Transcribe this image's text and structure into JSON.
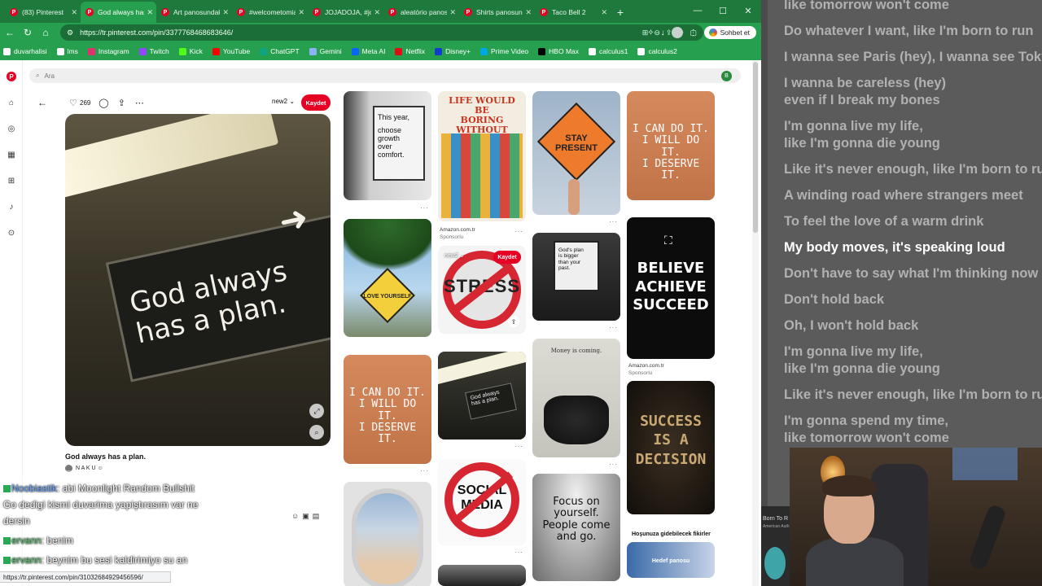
{
  "tabs": [
    {
      "label": "(83) Pinterest",
      "active": false
    },
    {
      "label": "God always has",
      "active": true
    },
    {
      "label": "Art panosundaki",
      "active": false
    },
    {
      "label": "#welcometomia",
      "active": false
    },
    {
      "label": "JOJADOJA, #joja",
      "active": false
    },
    {
      "label": "aleatório panos",
      "active": false
    },
    {
      "label": "Shirts panosund",
      "active": false
    },
    {
      "label": "Taco Bell 2",
      "active": false
    }
  ],
  "window": {
    "minimize": "—",
    "maximize": "☐",
    "close": "✕",
    "new_tab": "+"
  },
  "address": {
    "url": "https://tr.pinterest.com/pin/3377768468683646/"
  },
  "chat_button": "Sohbet et",
  "bookmarks": [
    {
      "label": "duvarhalisi",
      "color": "#ffffff"
    },
    {
      "label": "lms",
      "color": "#ffffff"
    },
    {
      "label": "Instagram",
      "color": "#e1306c"
    },
    {
      "label": "Twitch",
      "color": "#9146ff"
    },
    {
      "label": "Kick",
      "color": "#53fc18"
    },
    {
      "label": "YouTube",
      "color": "#ff0000"
    },
    {
      "label": "ChatGPT",
      "color": "#10a37f"
    },
    {
      "label": "Gemini",
      "color": "#8ab4f8"
    },
    {
      "label": "Meta AI",
      "color": "#0866ff"
    },
    {
      "label": "Netflix",
      "color": "#e50914"
    },
    {
      "label": "Disney+",
      "color": "#113ccf"
    },
    {
      "label": "Prime Video",
      "color": "#00a8e1"
    },
    {
      "label": "HBO Max",
      "color": "#000000"
    },
    {
      "label": "calculus1",
      "color": "#ffffff"
    },
    {
      "label": "calculus2",
      "color": "#ffffff"
    }
  ],
  "search": {
    "placeholder": "Ara"
  },
  "user_initial": "B",
  "pin": {
    "likes": "269",
    "board": "new2",
    "save_label": "Kaydet",
    "sign_line1": "God always",
    "sign_line2": "has a plan.",
    "title": "God always has a plan.",
    "author": "N A K U ☺"
  },
  "grid": {
    "this_year": [
      "This year,",
      "choose",
      "growth",
      "over",
      "comfort."
    ],
    "buses": [
      "LIFE WOULD BE",
      "BORING",
      "WITHOUT BUSES"
    ],
    "stay_present": [
      "STAY",
      "PRESENT"
    ],
    "i_can_do_it": [
      "I CAN DO IT.",
      "I WILL DO IT.",
      "I DESERVE IT."
    ],
    "love_yourself": "LOVE YOURSELF",
    "stress": "STRESS",
    "gods_plan": [
      "God's plan",
      "is bigger",
      "than your",
      "past."
    ],
    "believe": [
      "BELIEVE",
      "ACHIEVE",
      "SUCCEED"
    ],
    "money": "Money is coming.",
    "social_media": [
      "SOCIAL",
      "MEDIA"
    ],
    "focus": [
      "Focus on",
      "yourself.",
      "People come",
      "and go."
    ],
    "success": [
      "SUCCESS",
      "IS A",
      "DECISION"
    ],
    "hover_board": "new2",
    "hover_save": "Kaydet",
    "promo1": {
      "source": "Amazon.com.tr",
      "label": "Sponsorlu"
    },
    "promo2": {
      "source": "Amazon.com.tr",
      "label": "Sponsorlu"
    },
    "more_ideas": "Hoşunuza gidebilecek fikirler",
    "board_card": "Hedef panosu"
  },
  "chat": {
    "m1_user": "Noobiastik",
    "m1_text": ": abi Moonlight Random Bullshit Go dedigi kismi duvarima yapiştırasım var ne dersin",
    "m2_user": "ervann",
    "m2_text": ": benim",
    "m3_user": "ervann",
    "m3_text": ": beynim bu sesi kaldirimiyo su an"
  },
  "status_url": "https://tr.pinterest.com/pin/31032684929456596/",
  "lyrics": [
    {
      "text": "like tomorrow won't come",
      "active": false
    },
    {
      "text": "Do whatever I want, like I'm born to run",
      "active": false
    },
    {
      "text": "I wanna see Paris (hey), I wanna see Tokyo",
      "active": false
    },
    {
      "text": "I wanna be careless (hey)",
      "active": false
    },
    {
      "text": "even if I break my bones",
      "active": false
    },
    {
      "text": "I'm gonna live my life,",
      "active": false
    },
    {
      "text": "like I'm gonna die young",
      "active": false
    },
    {
      "text": "Like it's never enough, like I'm born to run",
      "active": false
    },
    {
      "text": "A winding road where strangers meet",
      "active": false
    },
    {
      "text": "To feel the love of a warm drink",
      "active": false
    },
    {
      "text": "My body moves, it's speaking loud",
      "active": true
    },
    {
      "text": "Don't have to say what I'm thinking now",
      "active": false
    },
    {
      "text": "Don't hold back",
      "active": false
    },
    {
      "text": "Oh, I won't hold back",
      "active": false
    },
    {
      "text": "I'm gonna live my life,",
      "active": false
    },
    {
      "text": "like I'm gonna die young",
      "active": false
    },
    {
      "text": "Like it's never enough, like I'm born to run",
      "active": false
    },
    {
      "text": "I'm gonna spend my time,",
      "active": false
    },
    {
      "text": "like tomorrow won't come",
      "active": false
    }
  ],
  "side_thumb": {
    "title": "Born To R",
    "subtitle": "American Auth"
  }
}
